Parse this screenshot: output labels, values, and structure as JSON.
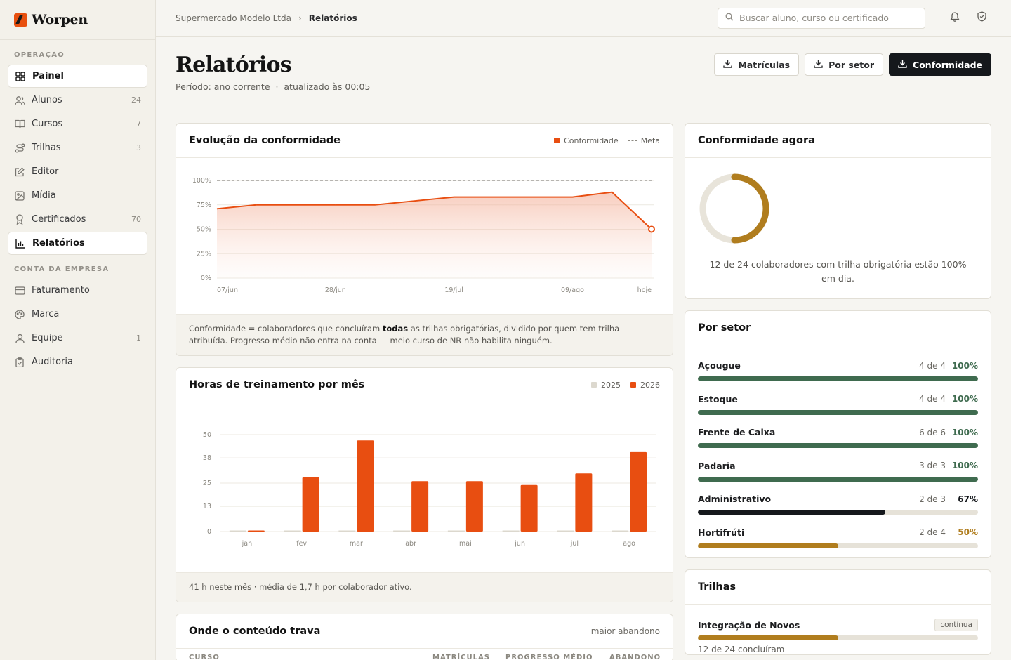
{
  "brand": {
    "name": "Worpen"
  },
  "sidebar": {
    "sections": [
      {
        "title": "OPERAÇÃO",
        "items": [
          {
            "label": "Painel",
            "icon": "grid-icon",
            "count": "",
            "active": true
          },
          {
            "label": "Alunos",
            "icon": "users-icon",
            "count": "24"
          },
          {
            "label": "Cursos",
            "icon": "book-icon",
            "count": "7"
          },
          {
            "label": "Trilhas",
            "icon": "route-icon",
            "count": "3"
          },
          {
            "label": "Editor",
            "icon": "edit-icon",
            "count": ""
          },
          {
            "label": "Mídia",
            "icon": "image-icon",
            "count": ""
          },
          {
            "label": "Certificados",
            "icon": "award-icon",
            "count": "70"
          },
          {
            "label": "Relatórios",
            "icon": "bar-chart-icon",
            "count": "",
            "active": true
          }
        ]
      },
      {
        "title": "CONTA DA EMPRESA",
        "items": [
          {
            "label": "Faturamento",
            "icon": "credit-card-icon",
            "count": ""
          },
          {
            "label": "Marca",
            "icon": "palette-icon",
            "count": ""
          },
          {
            "label": "Equipe",
            "icon": "user-icon",
            "count": "1"
          },
          {
            "label": "Auditoria",
            "icon": "clipboard-icon",
            "count": ""
          }
        ]
      }
    ]
  },
  "topbar": {
    "breadcrumb": [
      "Supermercado Modelo Ltda",
      "Relatórios"
    ],
    "search_placeholder": "Buscar aluno, curso ou certificado"
  },
  "page": {
    "title": "Relatórios",
    "subtitle": "Período: ano corrente  ·  atualizado às 00:05",
    "actions": [
      "Matrículas",
      "Por setor",
      "Conformidade"
    ]
  },
  "conformity_card": {
    "title": "Evolução da conformidade",
    "legend": [
      "Conformidade",
      "Meta"
    ],
    "footnote_pre": "Conformidade = colaboradores que concluíram ",
    "footnote_bold": "todas",
    "footnote_post": " as trilhas obrigatórias, dividido por quem tem trilha atribuída. Progresso médio não entra na conta — meio curso de NR não habilita ninguém."
  },
  "hours_card": {
    "title": "Horas de treinamento por mês",
    "legend": [
      "2025",
      "2026"
    ],
    "footnote": "41 h neste mês · média de 1,7 h por colaborador ativo."
  },
  "stuck_card": {
    "title": "Onde o conteúdo trava",
    "hint": "maior abandono",
    "columns": [
      "CURSO",
      "MATRÍCULAS",
      "PROGRESSO MÉDIO",
      "ABANDONO"
    ]
  },
  "now_card": {
    "title": "Conformidade agora",
    "value": 0.5,
    "caption": "12 de 24 colaboradores com trilha obrigatória estão 100% em dia."
  },
  "sector_card": {
    "title": "Por setor",
    "rows": [
      {
        "name": "Açougue",
        "count": "4 de 4",
        "pct": "100%",
        "value": 1.0,
        "color": "#3f6b4f"
      },
      {
        "name": "Estoque",
        "count": "4 de 4",
        "pct": "100%",
        "value": 1.0,
        "color": "#3f6b4f"
      },
      {
        "name": "Frente de Caixa",
        "count": "6 de 6",
        "pct": "100%",
        "value": 1.0,
        "color": "#3f6b4f"
      },
      {
        "name": "Padaria",
        "count": "3 de 3",
        "pct": "100%",
        "value": 1.0,
        "color": "#3f6b4f"
      },
      {
        "name": "Administrativo",
        "count": "2 de 3",
        "pct": "67%",
        "value": 0.67,
        "color": "#15181c"
      },
      {
        "name": "Hortifrúti",
        "count": "2 de 4",
        "pct": "50%",
        "value": 0.5,
        "color": "#b07d1e"
      }
    ]
  },
  "trails_card": {
    "title": "Trilhas",
    "items": [
      {
        "name": "Integração de Novos",
        "tag": "contínua",
        "sub": "12 de 24 concluíram",
        "value": 0.5
      }
    ]
  },
  "colors": {
    "accent": "#e84e11",
    "dark": "#15181c",
    "green": "#3f6b4f",
    "gold": "#b07d1e"
  },
  "chart_data": [
    {
      "type": "area",
      "title": "Evolução da conformidade",
      "x": [
        "07/jun",
        "14/jun",
        "21/jun",
        "28/jun",
        "05/jul",
        "12/jul",
        "19/jul",
        "26/jul",
        "02/ago",
        "09/ago",
        "16/ago",
        "hoje"
      ],
      "tick_labels": [
        "07/jun",
        "28/jun",
        "19/jul",
        "09/ago",
        "hoje"
      ],
      "series": [
        {
          "name": "Conformidade",
          "values": [
            71,
            75,
            75,
            75,
            75,
            79,
            83,
            83,
            83,
            83,
            88,
            50
          ]
        },
        {
          "name": "Meta",
          "values": [
            100,
            100,
            100,
            100,
            100,
            100,
            100,
            100,
            100,
            100,
            100,
            100
          ]
        }
      ],
      "yticks": [
        "100%",
        "75%",
        "50%",
        "25%",
        "0%"
      ],
      "ylim": [
        0,
        100
      ]
    },
    {
      "type": "bar",
      "title": "Horas de treinamento por mês",
      "categories": [
        "jan",
        "fev",
        "mar",
        "abr",
        "mai",
        "jun",
        "jul",
        "ago"
      ],
      "series": [
        {
          "name": "2025",
          "values": [
            0,
            0,
            0,
            0,
            0,
            0,
            0,
            0
          ]
        },
        {
          "name": "2026",
          "values": [
            0.5,
            28,
            47,
            26,
            26,
            24,
            30,
            41
          ]
        }
      ],
      "yticks": [
        "50",
        "38",
        "25",
        "13",
        "0"
      ],
      "ylim": [
        0,
        50
      ]
    }
  ]
}
